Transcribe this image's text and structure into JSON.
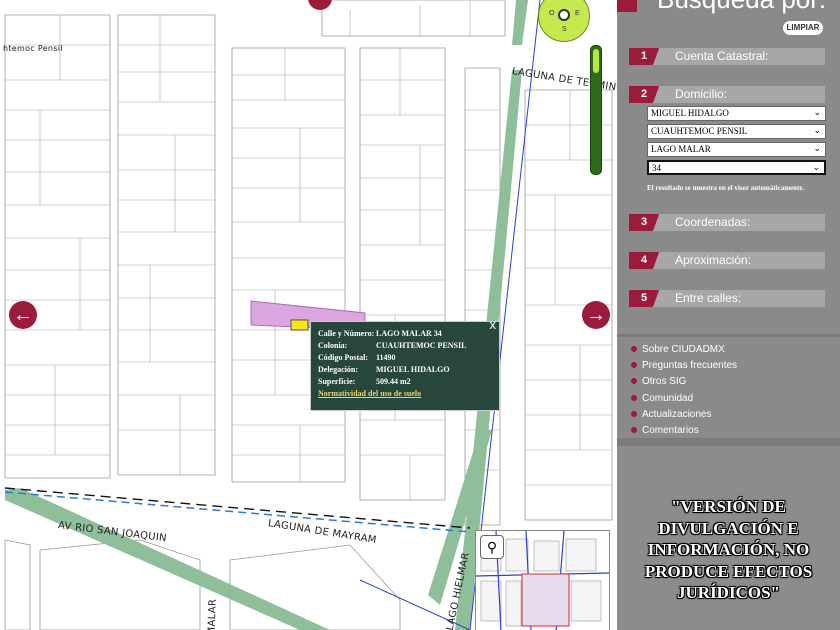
{
  "sidebar": {
    "title": "Búsqueda por:",
    "clear_label": "LIMPIAR",
    "sections": [
      {
        "num": "1",
        "label": "Cuenta Catastral:"
      },
      {
        "num": "2",
        "label": "Domicilio:"
      },
      {
        "num": "3",
        "label": "Coordenadas:"
      },
      {
        "num": "4",
        "label": "Aproximación:"
      },
      {
        "num": "5",
        "label": "Entre calles:"
      }
    ],
    "domicilio": {
      "delegacion": "MIGUEL HIDALGO",
      "colonia": "CUAUHTEMOC PENSIL",
      "calle": "LAGO MALAR",
      "numero": "34",
      "note": "El resultado se muestra en el visor automáticamente."
    },
    "links": [
      "Sobre CIUDADMX",
      "Preguntas frecuentes",
      "Otros SIG",
      "Comunidad",
      "Actualizaciones",
      "Comentarios"
    ],
    "disclaimer": "\"VERSIÓN DE DIVULGACIÓN E INFORMACIÓN, NO PRODUCE EFECTOS JURÍDICOS\""
  },
  "popup": {
    "rows": [
      {
        "k": "Calle y Número:",
        "v": "LAGO MALAR 34"
      },
      {
        "k": "Colonia:",
        "v": "CUAUHTEMOC PENSIL"
      },
      {
        "k": "Código Postal:",
        "v": "11490"
      },
      {
        "k": "Delegación:",
        "v": "MIGUEL HIDALGO"
      },
      {
        "k": "Superficie:",
        "v": "509.44 m2"
      }
    ],
    "link": "Normatividad del uso de suelo",
    "close": "X"
  },
  "map": {
    "streets": {
      "termino": "LAGUNA DE TERMINOS",
      "san_joaquin": "AV RIO SAN JOAQUIN",
      "mayram": "LAGUNA DE MAYRAM",
      "hielmar": "LAGO HIELMAR",
      "malar": "MALAR",
      "pensil": "htemoc Pensil"
    },
    "compass": {
      "n": "N",
      "s": "S",
      "e": "E",
      "o": "O"
    },
    "colors": {
      "accent": "#9b1c3a",
      "parcel": "#dca6e0",
      "avenue": "#8fbf9a",
      "popup": "#27473a"
    }
  }
}
